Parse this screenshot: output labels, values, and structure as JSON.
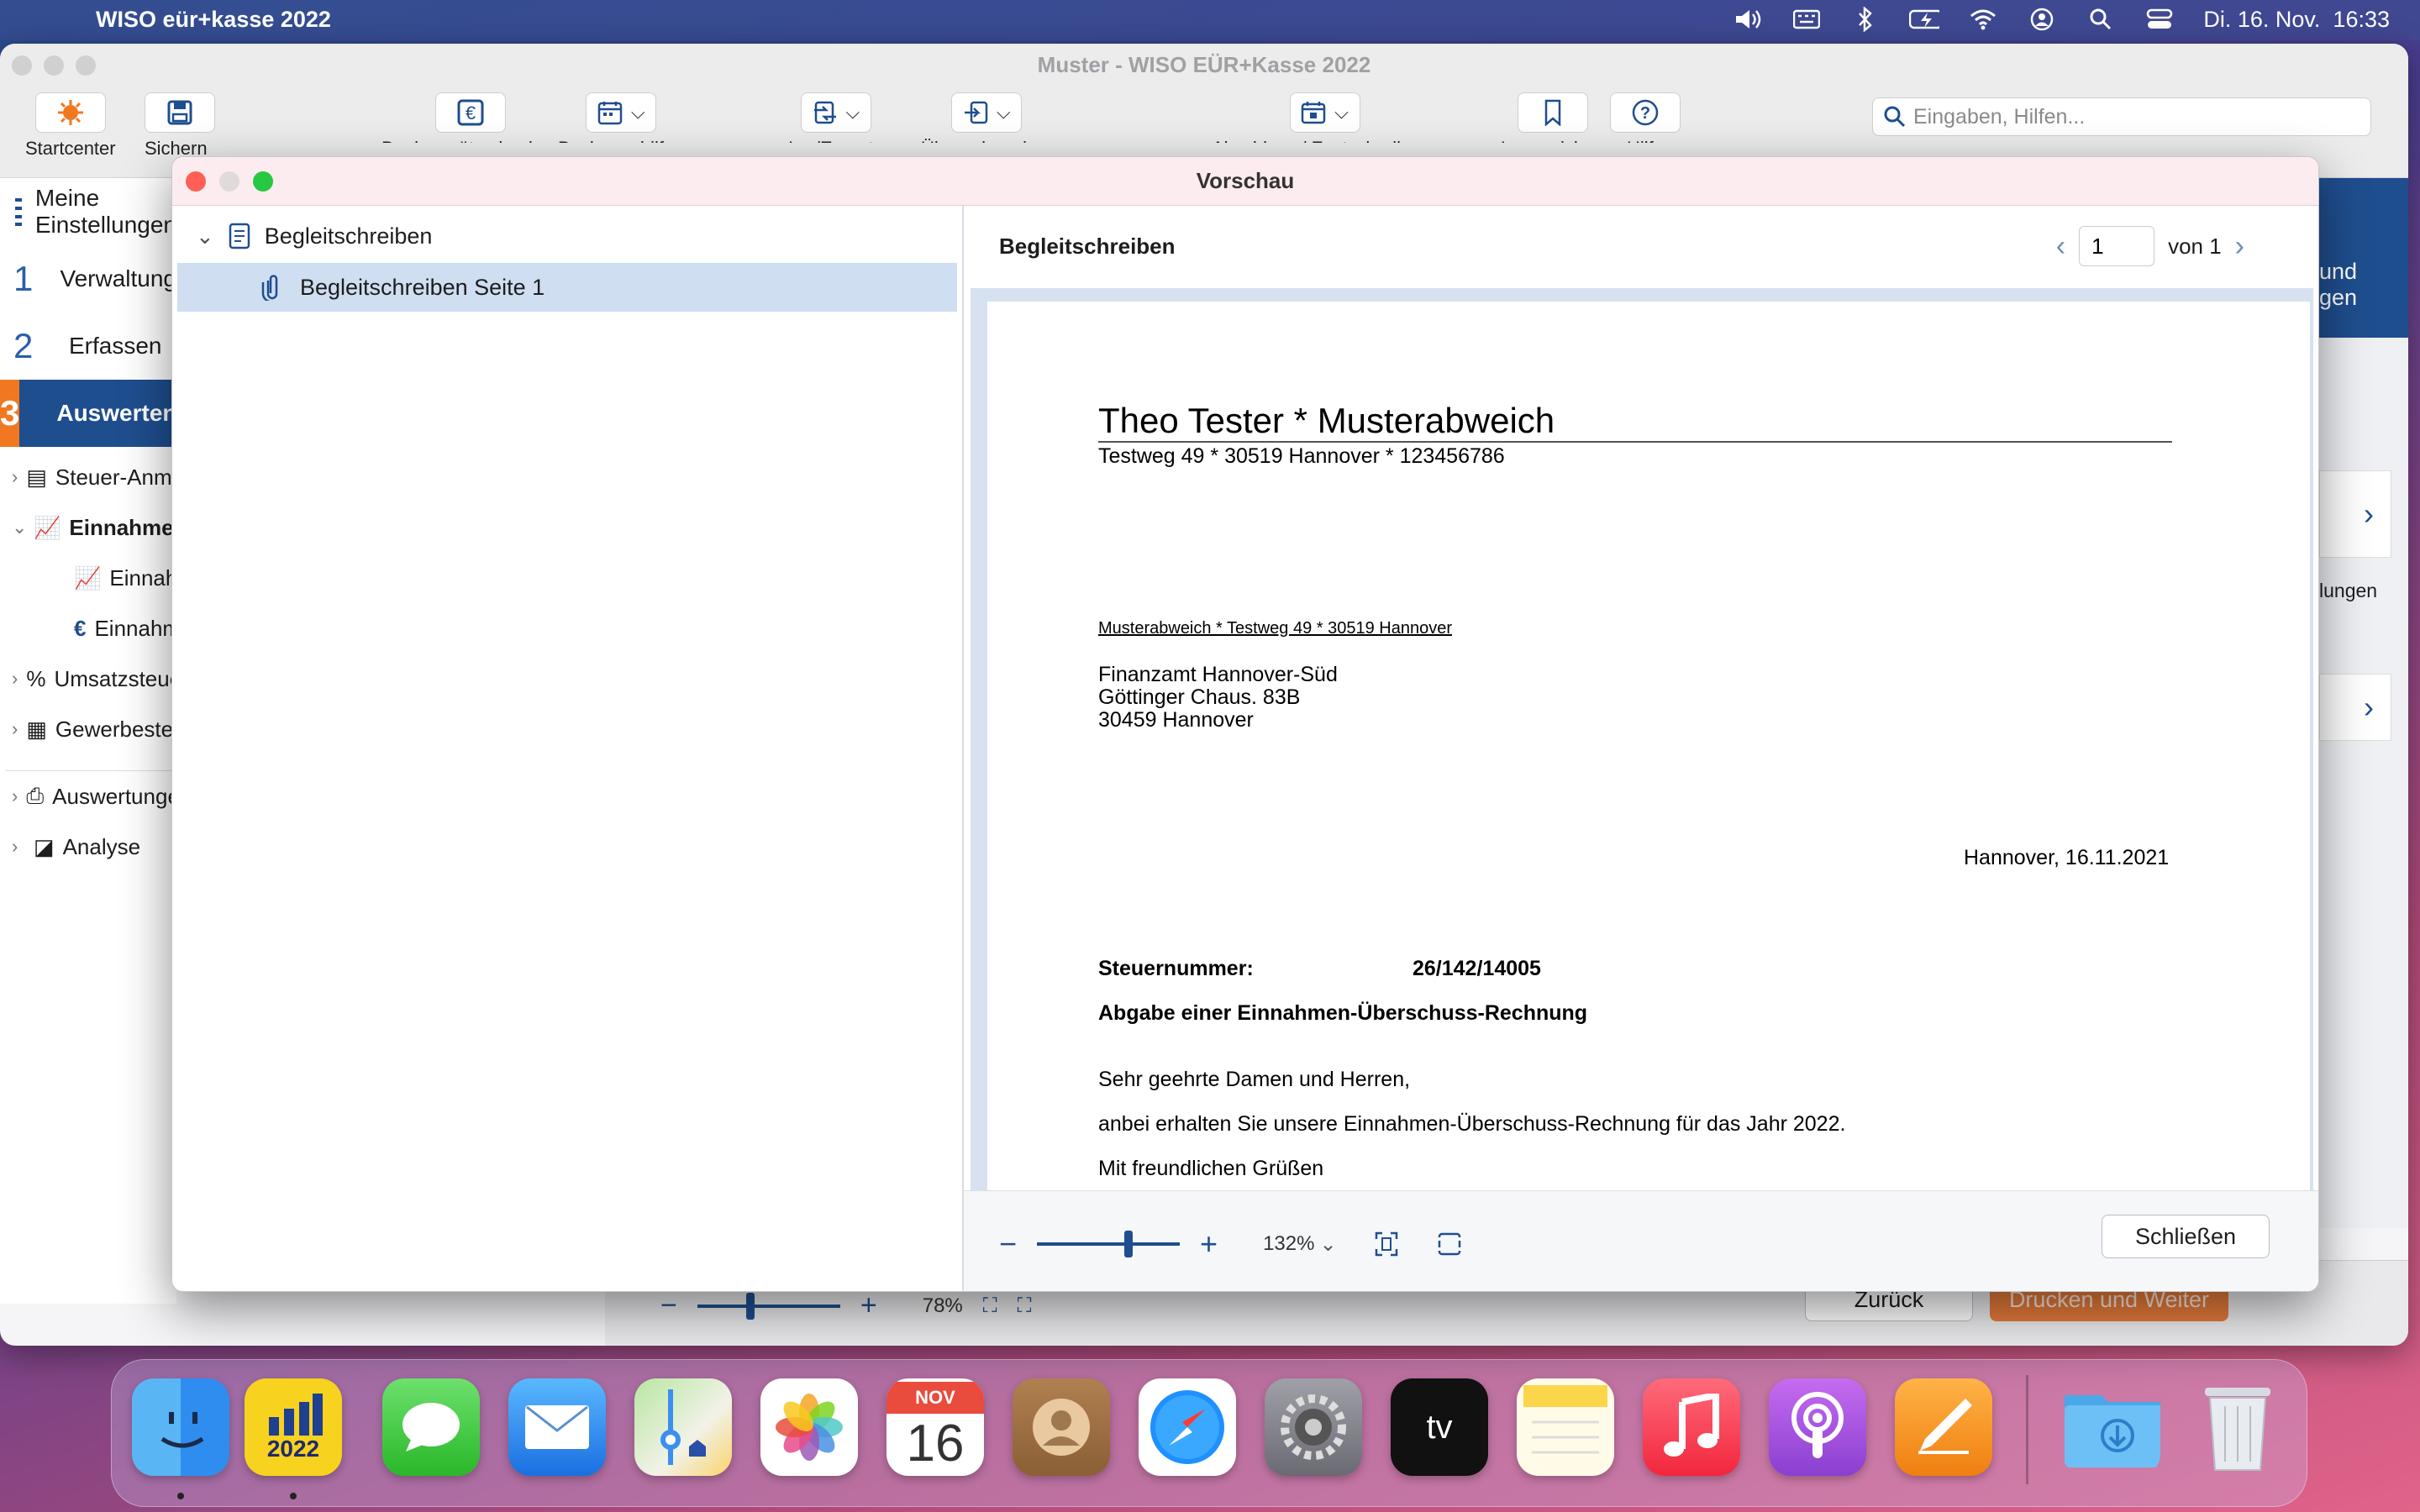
{
  "menubar": {
    "app_name": "WISO eür+kasse 2022",
    "datetime": "Di. 16. Nov.  16:33"
  },
  "app": {
    "window_title": "Muster - WISO EÜR+Kasse 2022",
    "toolbar": {
      "startcenter": "Startcenter",
      "sichern": "Sichern",
      "bankumsaetze": "Bankumsätze buchen",
      "buchungshilfen": "Buchungshilfen",
      "im_export": "Im-/Exporte",
      "uebernahme": "Übernahme in...",
      "abschluss": "Abschluss / Festschreibung",
      "lesezeichen": "Lesezeichen",
      "hilfe": "Hilfe"
    },
    "search_placeholder": "Eingaben, Hilfen...",
    "sidebar": {
      "meine": "Meine Einstellungen",
      "nav1_num": "1",
      "nav1": "Verwaltung",
      "nav2_num": "2",
      "nav2": "Erfassen",
      "nav3_num": "3",
      "nav3": "Auswerten",
      "tree": [
        "Steuer-Anmeldungen",
        "Einnahmen-Überschuss-Rechnung",
        "Einnahmen-Überschuss-Rechnung",
        "Einnahmen-Überschuss-Rechnung",
        "Umsatzsteuer",
        "Gewerbesteuer",
        "Auswertungen",
        "Analyse"
      ]
    },
    "right_partial": {
      "text1": "und",
      "text2": "gen",
      "text3": "lungen"
    },
    "bottom": {
      "zoom": "78%",
      "zurueck": "Zurück",
      "drucken": "Drucken und Weiter"
    }
  },
  "modal": {
    "title": "Vorschau",
    "tree_root": "Begleitschreiben",
    "tree_child": "Begleitschreiben Seite 1",
    "preview_title": "Begleitschreiben",
    "page_current": "1",
    "page_total": "von 1",
    "zoom": "132%",
    "close_label": "Schließen"
  },
  "letter": {
    "sender_name": "Theo Tester  *  Musterabweich",
    "sender_address": "Testweg 49  *  30519 Hannover  *  123456786",
    "return_line": "Musterabweich  *  Testweg 49  *  30519 Hannover",
    "recipient1": "Finanzamt Hannover-Süd",
    "recipient2": "Göttinger Chaus. 83B",
    "recipient3": "30459 Hannover",
    "date": "Hannover, 16.11.2021",
    "taxno_label": "Steuernummer:",
    "taxno": "26/142/14005",
    "subject": "Abgabe einer Einnahmen-Überschuss-Rechnung",
    "salutation": "Sehr geehrte Damen und Herren,",
    "body": "anbei erhalten Sie unsere Einnahmen-Überschuss-Rechnung für das Jahr 2022.",
    "closing": "Mit freundlichen Grüßen"
  },
  "dock": {
    "wiso_year": "2022",
    "cal_month": "NOV",
    "cal_day": "16",
    "tv": "tv"
  },
  "colors": {
    "accent": "#1f4e8f",
    "orange": "#f07820",
    "selection": "#cfdef0"
  }
}
